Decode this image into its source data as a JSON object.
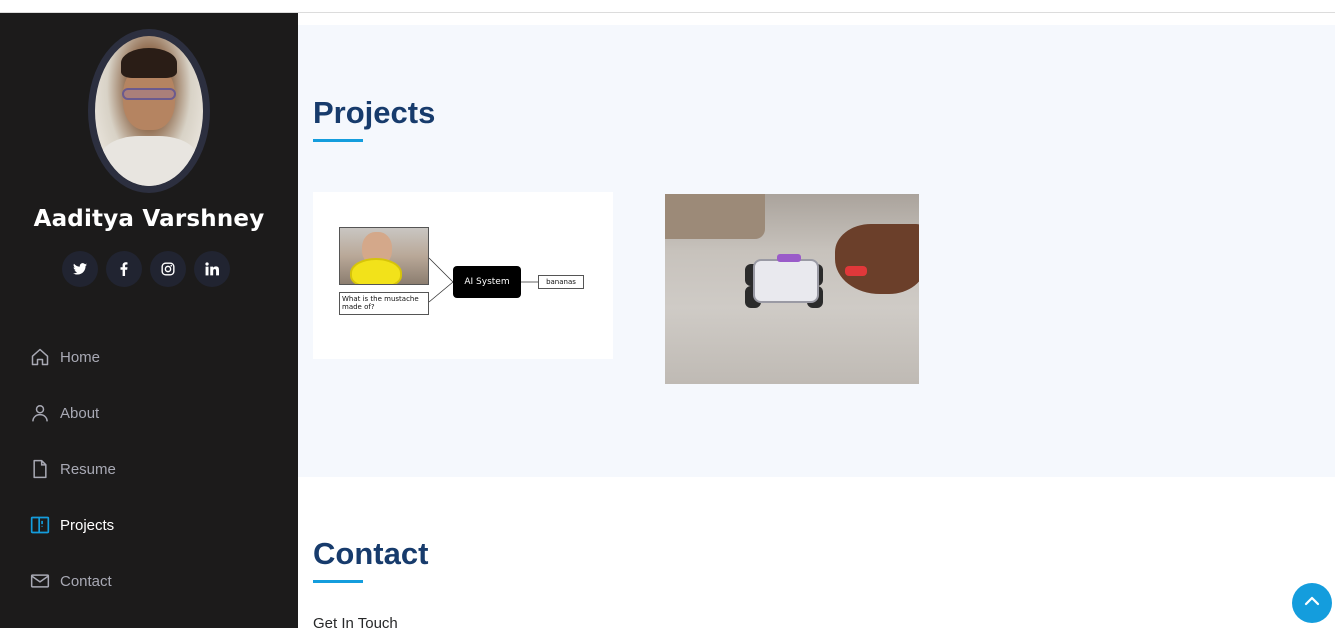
{
  "sidebar": {
    "profile_name": "Aaditya Varshney",
    "socials": [
      {
        "icon": "twitter-icon",
        "glyph": "🐦"
      },
      {
        "icon": "facebook-icon",
        "glyph": "f"
      },
      {
        "icon": "instagram-icon",
        "glyph": "◎"
      },
      {
        "icon": "linkedin-icon",
        "glyph": "in"
      }
    ],
    "nav": [
      {
        "label": "Home",
        "icon": "home-icon"
      },
      {
        "label": "About",
        "icon": "person-icon"
      },
      {
        "label": "Resume",
        "icon": "file-icon"
      },
      {
        "label": "Projects",
        "icon": "layout-icon",
        "active": true
      },
      {
        "label": "Contact",
        "icon": "envelope-icon"
      }
    ]
  },
  "projects": {
    "title": "Projects",
    "card1": {
      "question": "What is the mustache made of?",
      "ai_label": "AI System",
      "answer": "bananas"
    }
  },
  "contact": {
    "title": "Contact",
    "subtitle": "Get In Touch"
  },
  "colors": {
    "accent": "#149ddd",
    "heading": "#173b6c",
    "sidebar_bg": "#1c1b1b",
    "section_bg": "#f5f8fd"
  }
}
